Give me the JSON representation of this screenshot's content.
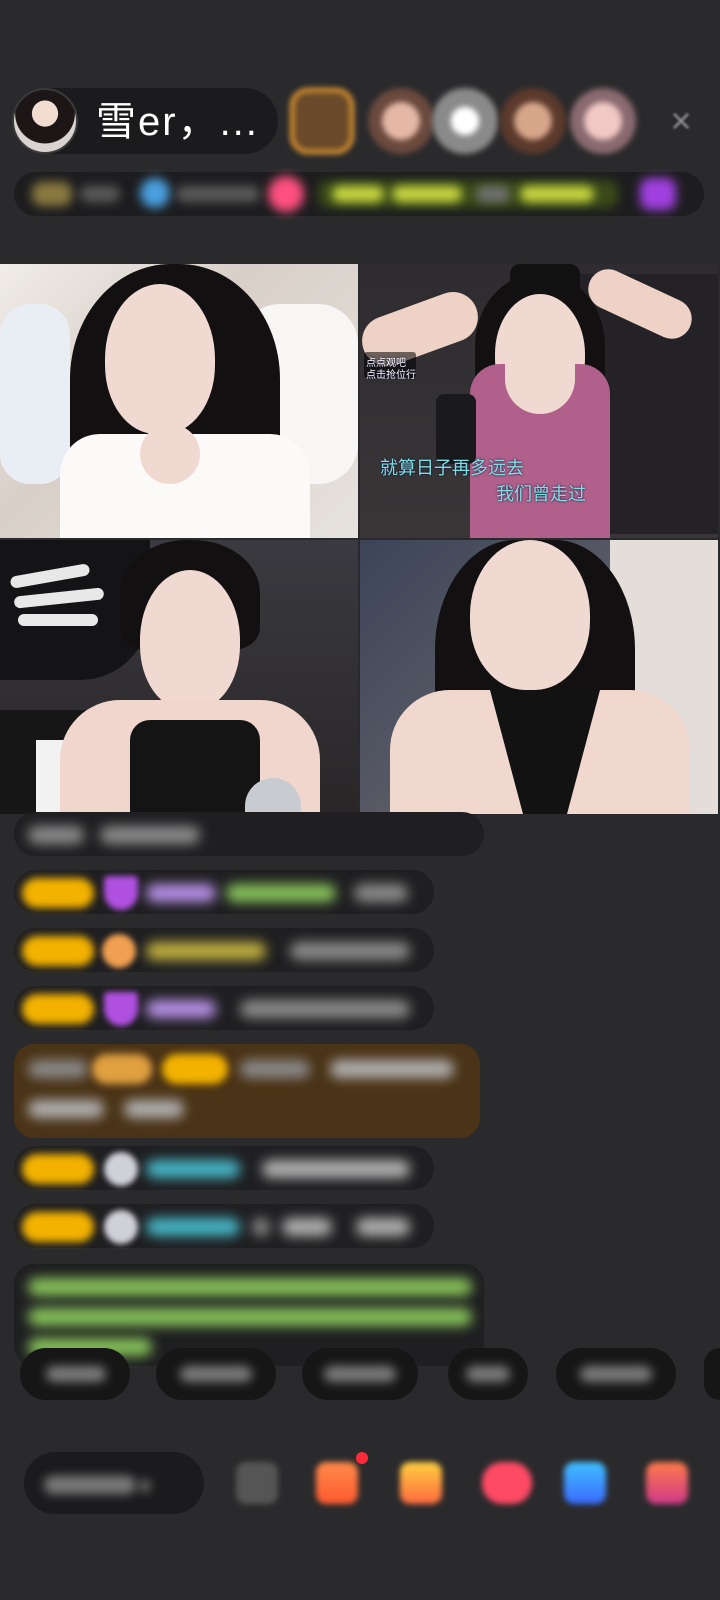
{
  "host": {
    "name": "雪er，...",
    "avatar_icon": "avatar-icon"
  },
  "close_icon": "×",
  "video_overlay_texts": {
    "tile2_small_top": "点点观吧",
    "tile2_small_bottom": "点击抢位行",
    "tile2_line1": "就算日子再多远去",
    "tile2_line2": "我们曾走过"
  },
  "colors": {
    "background": "#2a2a2c",
    "badge": "#f3b200",
    "chat_green": "#87c25a",
    "chat_cyan": "#46b6c6",
    "gift_highlight_row": "#4a3316"
  }
}
